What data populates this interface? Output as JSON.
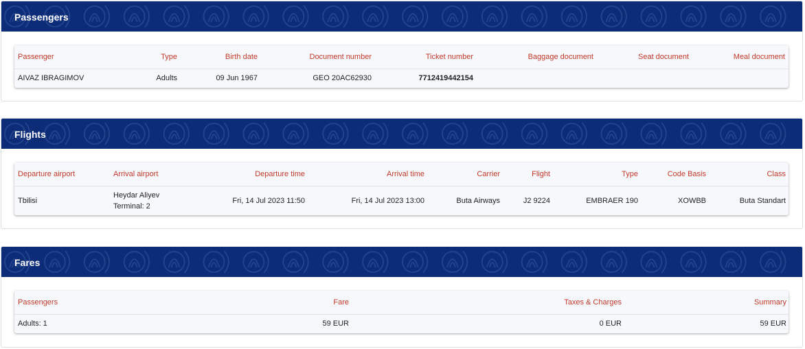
{
  "passengers": {
    "title": "Passengers",
    "headers": [
      "Passenger",
      "Type",
      "Birth date",
      "Document number",
      "Ticket number",
      "Baggage document",
      "Seat document",
      "Meal document"
    ],
    "rows": [
      {
        "passenger": "AIVAZ IBRAGIMOV",
        "type": "Adults",
        "birth_date": "09 Jun 1967",
        "document_number": "GEO 20AC62930",
        "ticket_number": "7712419442154",
        "baggage_document": "",
        "seat_document": "",
        "meal_document": ""
      }
    ]
  },
  "flights": {
    "title": "Flights",
    "headers": [
      "Departure airport",
      "Arrival airport",
      "Departure time",
      "Arrival time",
      "Carrier",
      "Flight",
      "Type",
      "Code Basis",
      "Class"
    ],
    "rows": [
      {
        "departure_airport": "Tbilisi",
        "arrival_airport": "Heydar Aliyev",
        "arrival_terminal": "Terminal: 2",
        "departure_time": "Fri, 14 Jul 2023 11:50",
        "arrival_time": "Fri, 14 Jul 2023 13:00",
        "carrier": "Buta Airways",
        "flight": "J2 9224",
        "type": "EMBRAER 190",
        "code_basis": "XOWBB",
        "class": "Buta Standart"
      }
    ]
  },
  "fares": {
    "title": "Fares",
    "headers": [
      "Passengers",
      "Fare",
      "Taxes & Charges",
      "Summary"
    ],
    "rows": [
      {
        "passengers": "Adults: 1",
        "fare": "59 EUR",
        "taxes": "0 EUR",
        "summary": "59 EUR"
      }
    ]
  },
  "colors": {
    "banner": "#0c2c78",
    "header_text": "#c0392b"
  }
}
